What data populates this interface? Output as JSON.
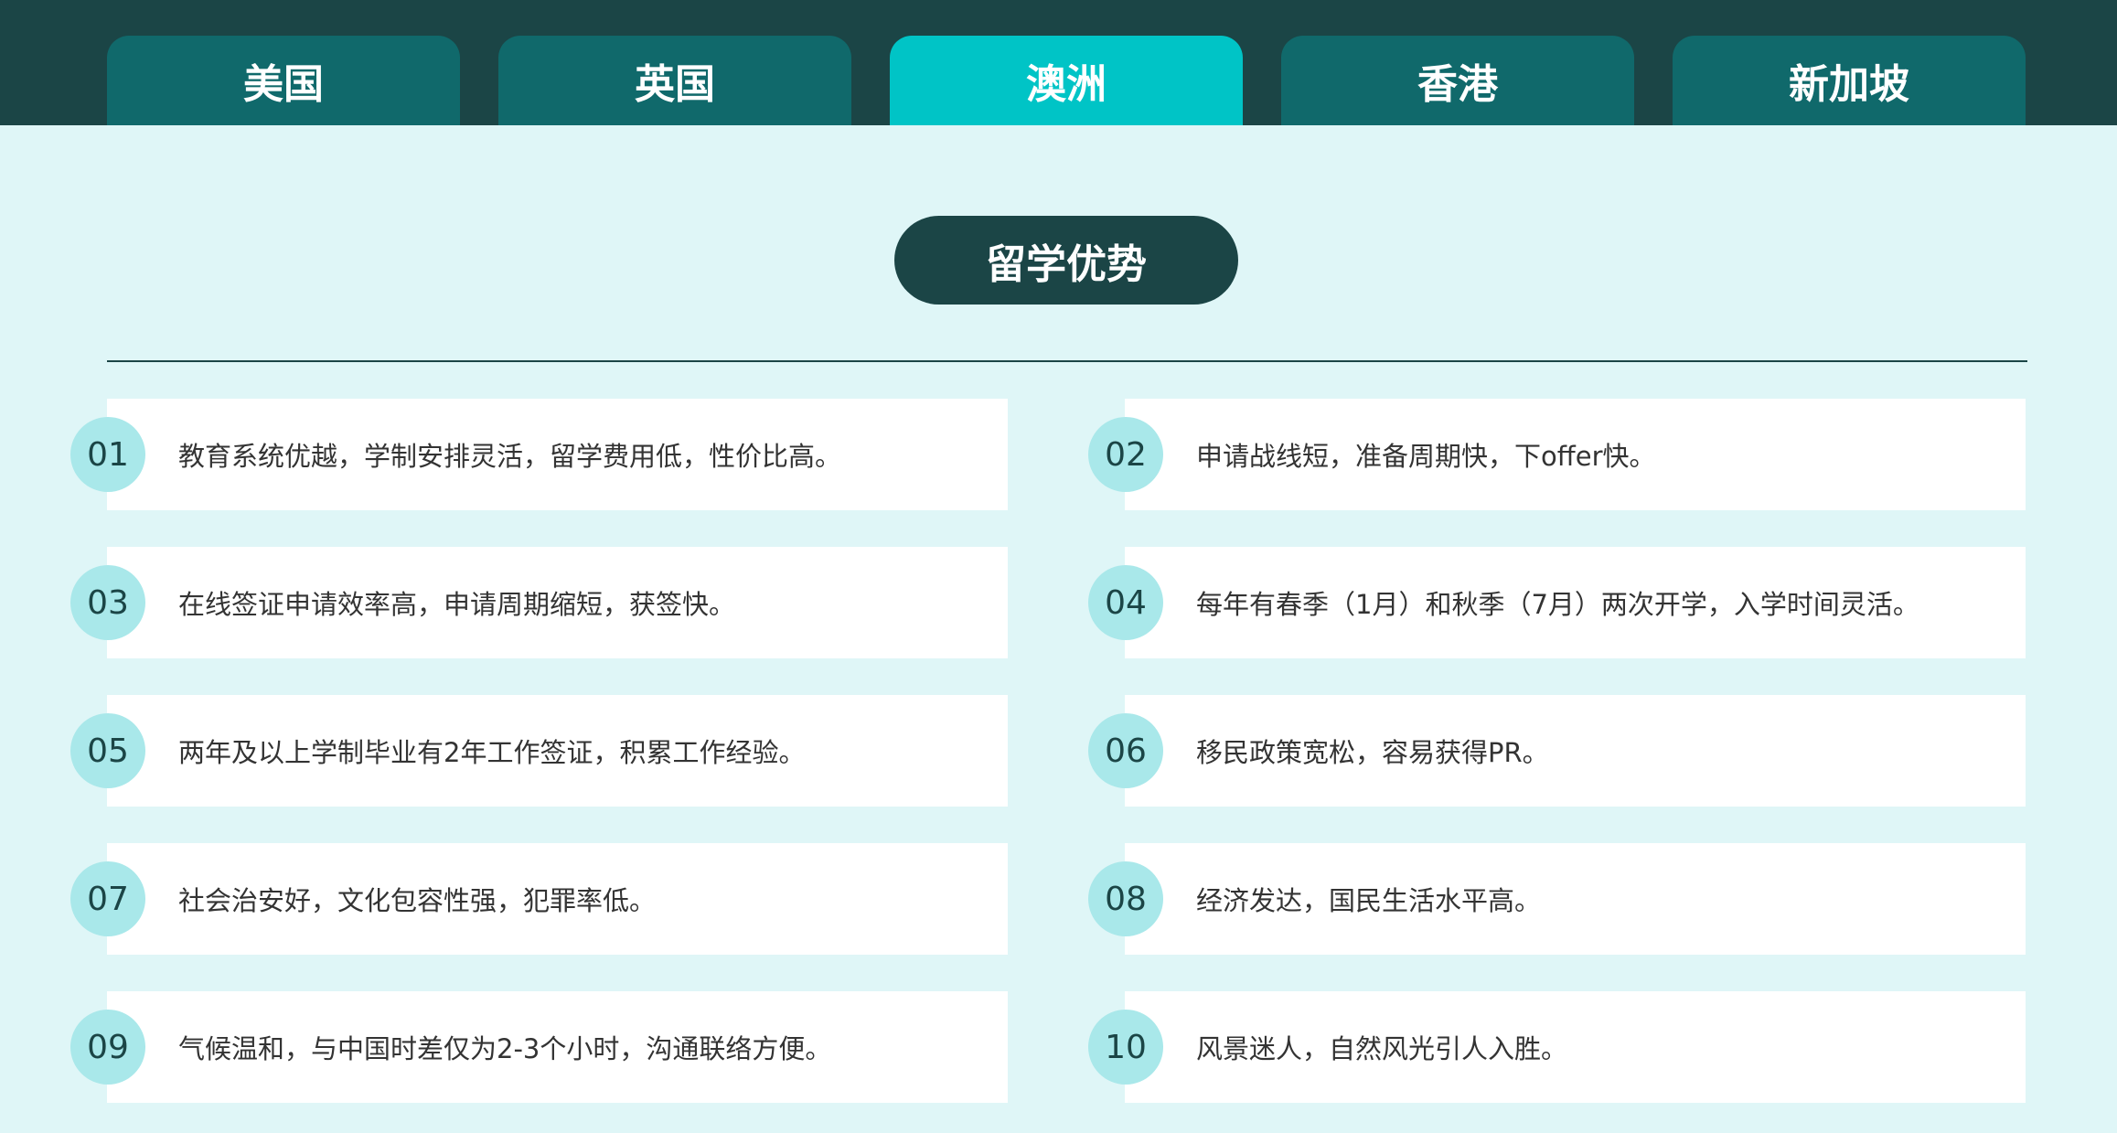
{
  "tabs": [
    {
      "label": "美国",
      "active": false
    },
    {
      "label": "英国",
      "active": false
    },
    {
      "label": "澳洲",
      "active": true
    },
    {
      "label": "香港",
      "active": false
    },
    {
      "label": "新加坡",
      "active": false
    }
  ],
  "section": {
    "title": "留学优势"
  },
  "advantages": [
    {
      "num": "01",
      "text": "教育系统优越，学制安排灵活，留学费用低，性价比高。"
    },
    {
      "num": "02",
      "text": "申请战线短，准备周期快，下offer快。"
    },
    {
      "num": "03",
      "text": "在线签证申请效率高，申请周期缩短，获签快。"
    },
    {
      "num": "04",
      "text": "每年有春季（1月）和秋季（7月）两次开学，入学时间灵活。"
    },
    {
      "num": "05",
      "text": "两年及以上学制毕业有2年工作签证，积累工作经验。"
    },
    {
      "num": "06",
      "text": "移民政策宽松，容易获得PR。"
    },
    {
      "num": "07",
      "text": "社会治安好，文化包容性强，犯罪率低。"
    },
    {
      "num": "08",
      "text": "经济发达，国民生活水平高。"
    },
    {
      "num": "09",
      "text": "气候温和，与中国时差仅为2-3个小时，沟通联络方便。"
    },
    {
      "num": "10",
      "text": "风景迷人，自然风光引人入胜。"
    }
  ],
  "colors": {
    "header_bg": "#1b4546",
    "tab_bg": "#10696b",
    "tab_active_bg": "#00c4c6",
    "page_bg": "#dff6f7",
    "badge_bg": "#a9e8ea"
  }
}
